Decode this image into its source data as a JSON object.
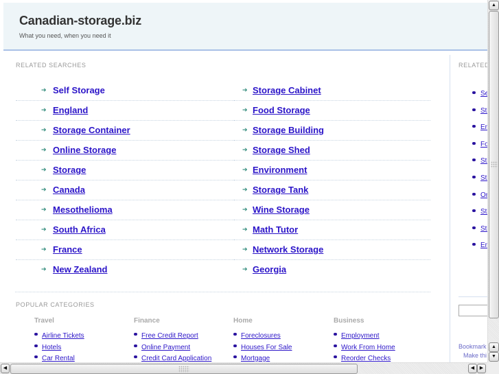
{
  "header": {
    "site_title": "Canadian-storage.biz",
    "tagline": "What you need, when you need it"
  },
  "related_searches": {
    "label": "RELATED SEARCHES",
    "left": [
      "Self Storage",
      "England",
      "Storage Container",
      "Online Storage",
      "Storage",
      "Canada",
      "Mesothelioma",
      "South Africa",
      "France",
      "New Zealand"
    ],
    "right": [
      "Storage Cabinet",
      "Food Storage",
      "Storage Building",
      "Storage Shed",
      "Environment",
      "Storage Tank",
      "Wine Storage",
      "Math Tutor",
      "Network Storage",
      "Georgia"
    ]
  },
  "popular_categories": {
    "label": "POPULAR CATEGORIES",
    "columns": [
      {
        "title": "Travel",
        "links": [
          "Airline Tickets",
          "Hotels",
          "Car Rental"
        ]
      },
      {
        "title": "Finance",
        "links": [
          "Free Credit Report",
          "Online Payment",
          "Credit Card Application"
        ]
      },
      {
        "title": "Home",
        "links": [
          "Foreclosures",
          "Houses For Sale",
          "Mortgage"
        ]
      },
      {
        "title": "Business",
        "links": [
          "Employment",
          "Work From Home",
          "Reorder Checks"
        ]
      }
    ]
  },
  "sidebar": {
    "label": "RELATED",
    "links": [
      "Se",
      "Sto",
      "En",
      "Fo",
      "Sto",
      "Sto",
      "Om",
      "Sto",
      "Sto",
      "En"
    ],
    "bookmark_text": "Bookmark",
    "make_this_text": "Make thi"
  },
  "scrollbars": {
    "up_glyph": "▲",
    "down_glyph": "▼",
    "left_glyph": "◀",
    "right_glyph": "▶"
  },
  "colors": {
    "link": "#2b14c8",
    "arrow": "#2f8a7a",
    "header_bg": "#eef5f8",
    "header_border": "#a9c0e6"
  }
}
